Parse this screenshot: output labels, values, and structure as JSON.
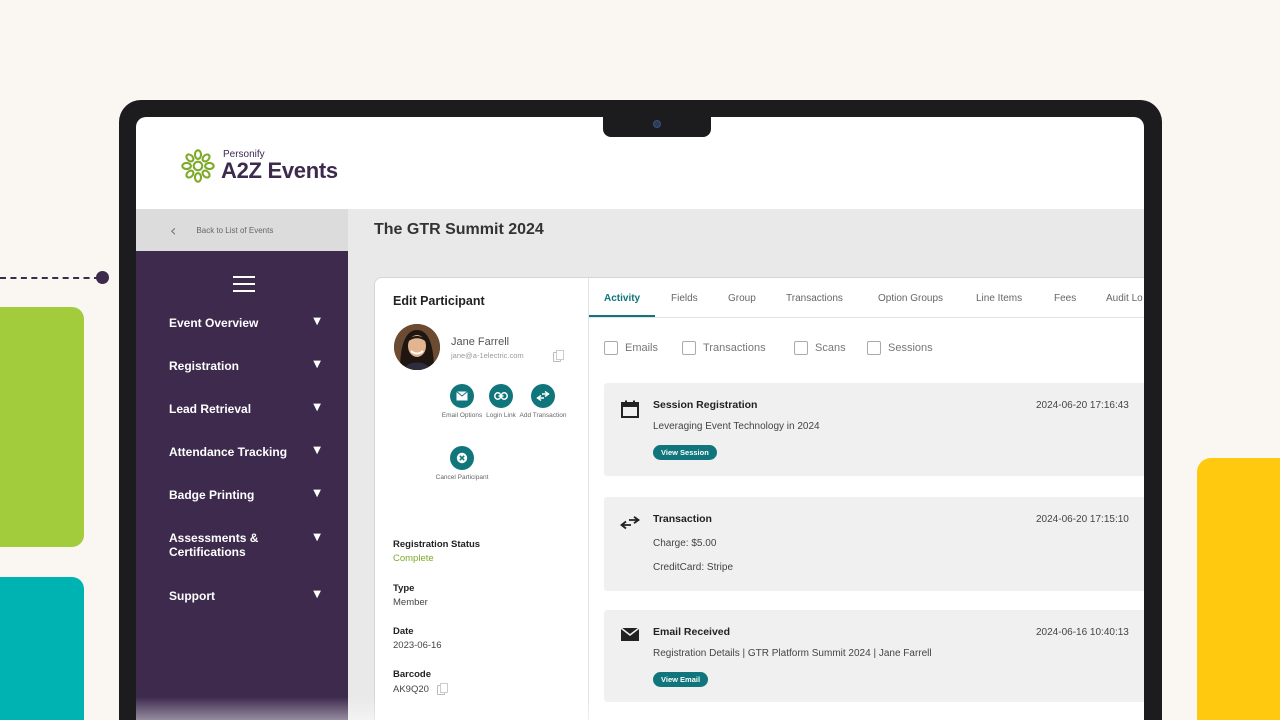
{
  "brand": {
    "company": "Personify",
    "product": "A2Z Events",
    "accent": "#11767b",
    "sidebar_bg": "#3d2a4d",
    "logo_green": "#7eaa2a"
  },
  "topbar": {
    "back_label": "Back to List of Events",
    "event_title": "The GTR Summit 2024"
  },
  "sidebar": {
    "items": [
      {
        "label": "Event Overview"
      },
      {
        "label": "Registration"
      },
      {
        "label": "Lead Retrieval"
      },
      {
        "label": "Attendance Tracking"
      },
      {
        "label": "Badge Printing"
      },
      {
        "label": "Assessments & Certifications"
      },
      {
        "label": "Support"
      }
    ]
  },
  "participant": {
    "panel_title": "Edit Participant",
    "name": "Jane Farrell",
    "email": "jane@a-1electric.com",
    "actions": [
      {
        "label": "Email Options",
        "icon": "email-icon"
      },
      {
        "label": "Login Link",
        "icon": "link-icon"
      },
      {
        "label": "Add Transaction",
        "icon": "transfer-icon"
      },
      {
        "label": "Cancel Participant",
        "icon": "cancel-icon"
      }
    ],
    "fields": [
      {
        "label": "Registration Status",
        "value": "Complete",
        "status_color": "#7eaa2a"
      },
      {
        "label": "Type",
        "value": "Member"
      },
      {
        "label": "Date",
        "value": "2023-06-16"
      },
      {
        "label": "Barcode",
        "value": "AK9Q20"
      }
    ]
  },
  "tabs": [
    {
      "label": "Activity",
      "active": true
    },
    {
      "label": "Fields"
    },
    {
      "label": "Group"
    },
    {
      "label": "Transactions"
    },
    {
      "label": "Option Groups"
    },
    {
      "label": "Line Items"
    },
    {
      "label": "Fees"
    },
    {
      "label": "Audit Lo"
    }
  ],
  "filters": [
    {
      "label": "Emails",
      "checked": false
    },
    {
      "label": "Transactions",
      "checked": false
    },
    {
      "label": "Scans",
      "checked": false
    },
    {
      "label": "Sessions",
      "checked": false
    }
  ],
  "activities": [
    {
      "type": "session",
      "icon": "calendar-icon",
      "title": "Session Registration",
      "timestamp": "2024-06-20  17:16:43",
      "lines": [
        "Leveraging Event Technology in 2024"
      ],
      "button": "View Session"
    },
    {
      "type": "transaction",
      "icon": "transfer-icon",
      "title": "Transaction",
      "timestamp": "2024-06-20  17:15:10",
      "lines": [
        "Charge: $5.00",
        "CreditCard: Stripe"
      ]
    },
    {
      "type": "email",
      "icon": "email-icon",
      "title": "Email Received",
      "timestamp": "2024-06-16  10:40:13",
      "lines": [
        "Registration Details  |  GTR Platform Summit 2024  |  Jane Farrell"
      ],
      "button": "View Email"
    }
  ]
}
